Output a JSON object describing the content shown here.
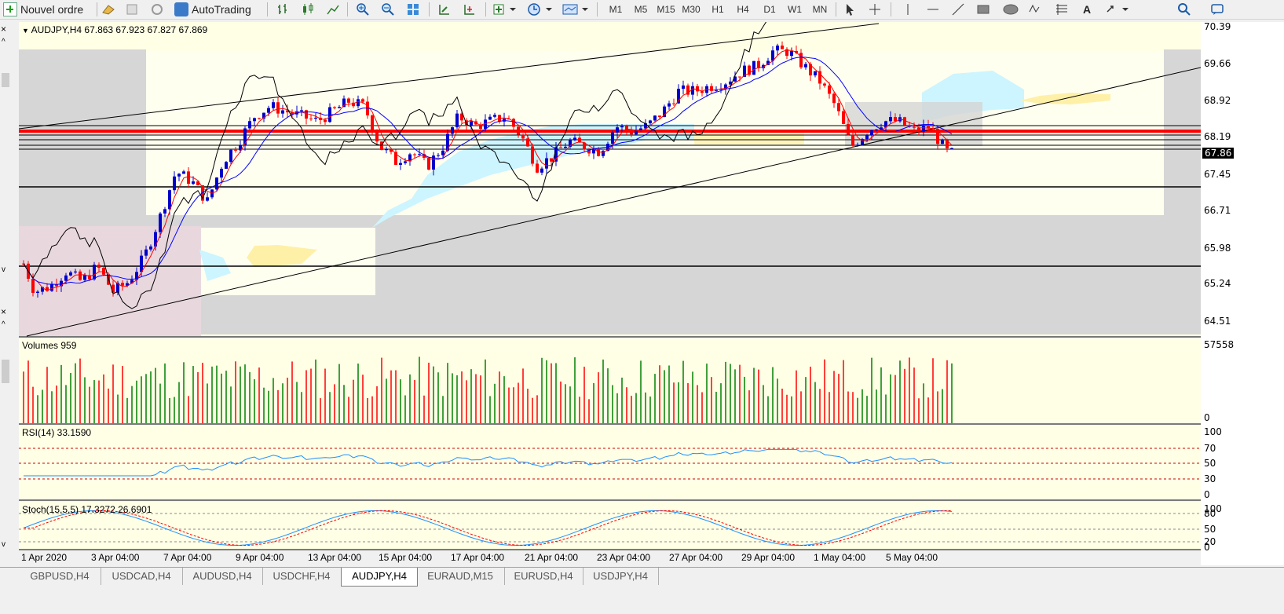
{
  "toolbar": {
    "new_order": "Nouvel ordre",
    "autotrading": "AutoTrading",
    "timeframes": [
      "M1",
      "M5",
      "M15",
      "M30",
      "H1",
      "H4",
      "D1",
      "W1",
      "MN"
    ]
  },
  "chart": {
    "header": "AUDJPY,H4  67.863 67.923 67.827 67.869",
    "current_price": "67.86",
    "price_ticks": [
      "70.39",
      "69.66",
      "68.92",
      "68.19",
      "67.45",
      "66.71",
      "65.98",
      "65.24",
      "64.51"
    ]
  },
  "volumes": {
    "label": "Volumes 959",
    "max_tick": "57558",
    "min_tick": "0"
  },
  "rsi": {
    "label": "RSI(14) 33.1590",
    "ticks": [
      "100",
      "70",
      "50",
      "30",
      "0"
    ]
  },
  "stoch": {
    "label": "Stoch(15,5,5) 17.3272 26.6901",
    "ticks": [
      "100",
      "80",
      "50",
      "20",
      "0"
    ]
  },
  "time_labels": [
    "1 Apr 2020",
    "3 Apr 04:00",
    "7 Apr 04:00",
    "9 Apr 04:00",
    "13 Apr 04:00",
    "15 Apr 04:00",
    "17 Apr 04:00",
    "21 Apr 04:00",
    "23 Apr 04:00",
    "27 Apr 04:00",
    "29 Apr 04:00",
    "1 May 04:00",
    "5 May 04:00"
  ],
  "tabs": [
    {
      "label": "GBPUSD,H4",
      "active": false
    },
    {
      "label": "USDCAD,H4",
      "active": false
    },
    {
      "label": "AUDUSD,H4",
      "active": false
    },
    {
      "label": "USDCHF,H4",
      "active": false
    },
    {
      "label": "AUDJPY,H4",
      "active": true
    },
    {
      "label": "EURAUD,M15",
      "active": false
    },
    {
      "label": "EURUSD,H4",
      "active": false
    },
    {
      "label": "USDJPY,H4",
      "active": false
    }
  ],
  "colors": {
    "bull": "#0000cc",
    "bear": "#ff0000",
    "vol_up": "#008000",
    "vol_down": "#ff0000",
    "kumo_bull": "#ccf5ff",
    "kumo_bear": "#fff0a8",
    "rsi": "#1e90ff",
    "bg": "#ffffe6"
  }
}
